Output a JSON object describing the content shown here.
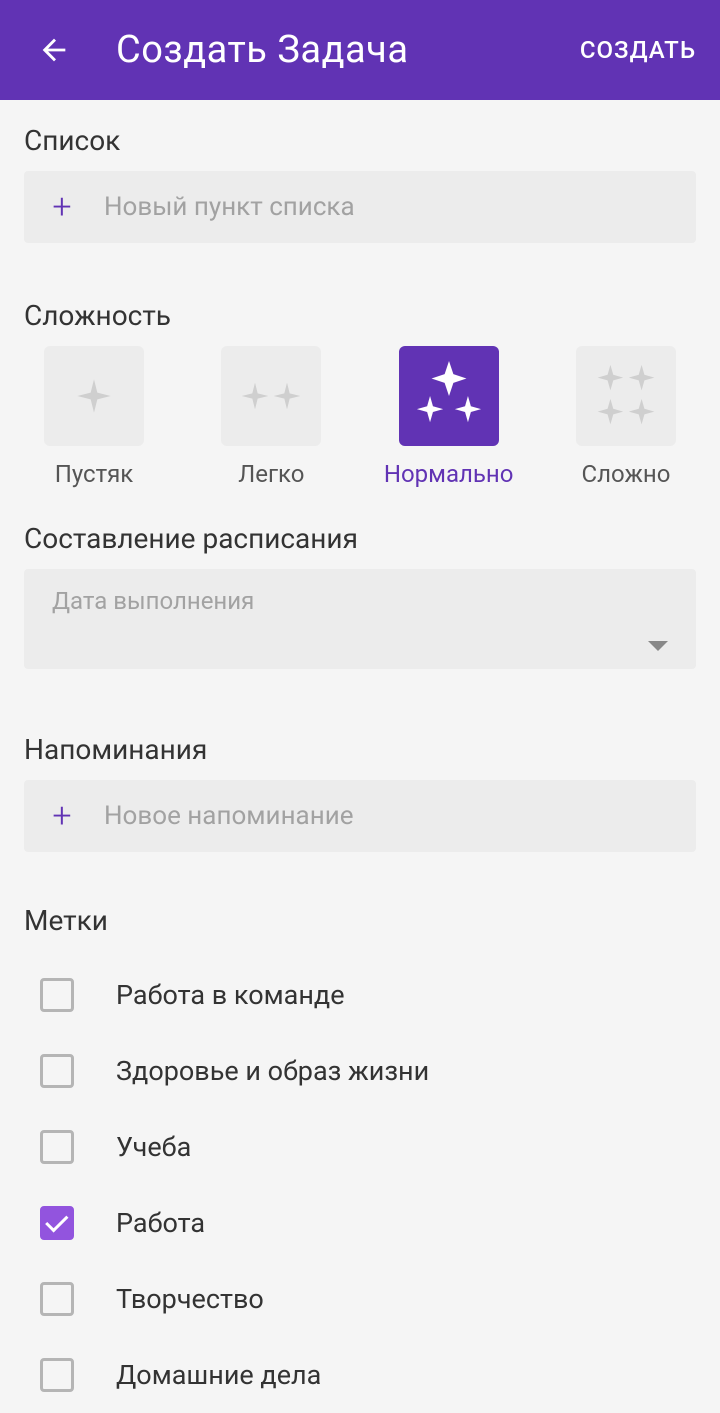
{
  "header": {
    "title": "Создать Задача",
    "action": "СОЗДАТЬ"
  },
  "list_section": {
    "label": "Список",
    "placeholder": "Новый пункт списка"
  },
  "difficulty_section": {
    "label": "Сложность",
    "options": [
      {
        "label": "Пустяк",
        "selected": false
      },
      {
        "label": "Легко",
        "selected": false
      },
      {
        "label": "Нормально",
        "selected": true
      },
      {
        "label": "Сложно",
        "selected": false
      }
    ]
  },
  "schedule_section": {
    "label": "Составление расписания",
    "placeholder": "Дата выполнения"
  },
  "reminders_section": {
    "label": "Напоминания",
    "placeholder": "Новое напоминание"
  },
  "tags_section": {
    "label": "Метки",
    "items": [
      {
        "label": "Работа в команде",
        "checked": false
      },
      {
        "label": "Здоровье и образ жизни",
        "checked": false
      },
      {
        "label": "Учеба",
        "checked": false
      },
      {
        "label": "Работа",
        "checked": true
      },
      {
        "label": "Творчество",
        "checked": false
      },
      {
        "label": "Домашние дела",
        "checked": false
      }
    ]
  },
  "colors": {
    "primary": "#6133b4",
    "accent": "#9254de"
  }
}
